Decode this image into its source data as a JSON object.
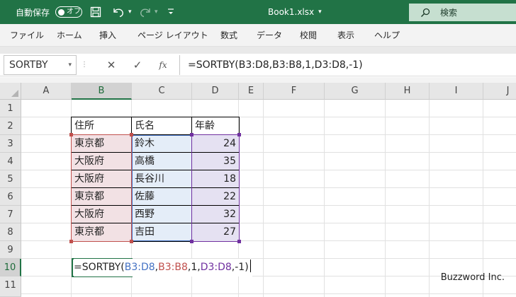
{
  "titlebar": {
    "autosave_label": "自動保存",
    "autosave_state": "オフ",
    "file_name": "Book1.xlsx",
    "file_menu_arrow": "▾",
    "search_placeholder": "検索",
    "accent_color": "#217346"
  },
  "ribbon_tabs": [
    "ファイル",
    "ホーム",
    "挿入",
    "ページ レイアウト",
    "数式",
    "データ",
    "校閲",
    "表示",
    "ヘルプ"
  ],
  "formula_bar": {
    "name_box": "SORTBY",
    "name_box_arrow": "▾",
    "cancel_glyph": "✕",
    "enter_glyph": "✓",
    "fx_label": "fx",
    "formula": "=SORTBY(B3:D8,B3:B8,1,D3:D8,-1)"
  },
  "grid": {
    "columns": [
      "A",
      "B",
      "C",
      "D",
      "E",
      "F",
      "G",
      "H",
      "I",
      "J"
    ],
    "rows": [
      "1",
      "2",
      "3",
      "4",
      "5",
      "6",
      "7",
      "8",
      "9",
      "10",
      "11"
    ],
    "selected_column": "B",
    "selected_row": "10"
  },
  "table": {
    "headers": [
      "住所",
      "氏名",
      "年齢"
    ],
    "rows": [
      [
        "東京都",
        "鈴木",
        "24"
      ],
      [
        "大阪府",
        "高橋",
        "35"
      ],
      [
        "大阪府",
        "長谷川",
        "18"
      ],
      [
        "東京都",
        "佐藤",
        "22"
      ],
      [
        "大阪府",
        "西野",
        "32"
      ],
      [
        "東京都",
        "吉田",
        "27"
      ]
    ]
  },
  "edit_formula": {
    "prefix": "=SORTBY(",
    "arg1": "B3:D8",
    "comma1": ",",
    "arg2": "B3:B8",
    "mid": ",1,",
    "arg3": "D3:D8",
    "suffix": ",-1)",
    "arg1_color": "#4472c4",
    "arg2_color": "#c0504d",
    "arg3_color": "#7030a0"
  },
  "watermark": "Buzzword Inc."
}
